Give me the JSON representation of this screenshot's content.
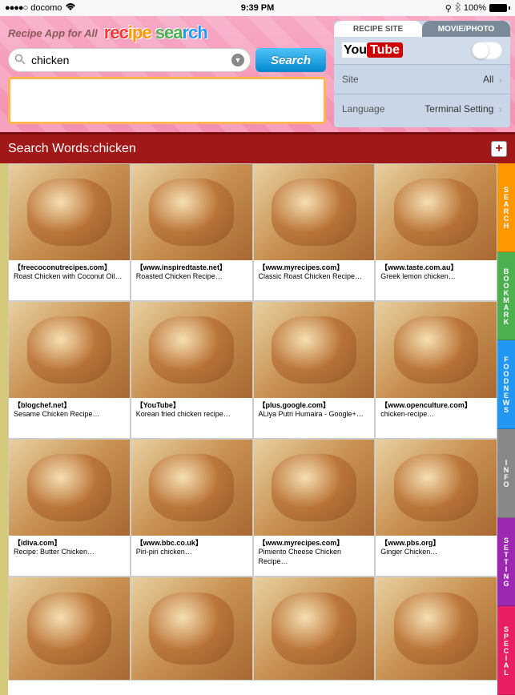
{
  "status": {
    "carrier": "docomo",
    "time": "9:39 PM",
    "battery": "100%"
  },
  "header": {
    "subtitle": "Recipe App for All",
    "search_value": "chicken",
    "search_button": "Search",
    "tabs": {
      "recipe": "RECIPE SITE",
      "movie": "MOVIE/PHOTO"
    },
    "youtube_row": {
      "label": "YouTube"
    },
    "site_row": {
      "label": "Site",
      "value": "All"
    },
    "lang_row": {
      "label": "Language",
      "value": "Terminal Setting"
    }
  },
  "search_words": {
    "label": "Search Words:",
    "value": "chicken"
  },
  "side_tabs": [
    "SEARCH",
    "BOOKMARK",
    "FOODNEWS",
    "INFO",
    "SETTING",
    "SPECIAL"
  ],
  "results": [
    {
      "source": "【freecoconutrecipes.com】",
      "title": "Roast Chicken with Coconut Oil…"
    },
    {
      "source": "【www.inspiredtaste.net】",
      "title": "Roasted Chicken Recipe…"
    },
    {
      "source": "【www.myrecipes.com】",
      "title": "Classic Roast Chicken Recipe…"
    },
    {
      "source": "【www.taste.com.au】",
      "title": "Greek lemon chicken…"
    },
    {
      "source": "【blogchef.net】",
      "title": "Sesame Chicken Recipe…"
    },
    {
      "source": "【YouTube】",
      "title": "Korean fried chicken recipe…"
    },
    {
      "source": "【plus.google.com】",
      "title": "ALiya Putri Humaira - Google+…"
    },
    {
      "source": "【www.openculture.com】",
      "title": "chicken-recipe…"
    },
    {
      "source": "【idiva.com】",
      "title": "Recipe: Butter Chicken…"
    },
    {
      "source": "【www.bbc.co.uk】",
      "title": "Piri-piri chicken…"
    },
    {
      "source": "【www.myrecipes.com】",
      "title": "Pimiento Cheese Chicken Recipe…"
    },
    {
      "source": "【www.pbs.org】",
      "title": "Ginger Chicken…"
    },
    {
      "source": "",
      "title": ""
    },
    {
      "source": "",
      "title": ""
    },
    {
      "source": "",
      "title": ""
    },
    {
      "source": "",
      "title": ""
    }
  ]
}
